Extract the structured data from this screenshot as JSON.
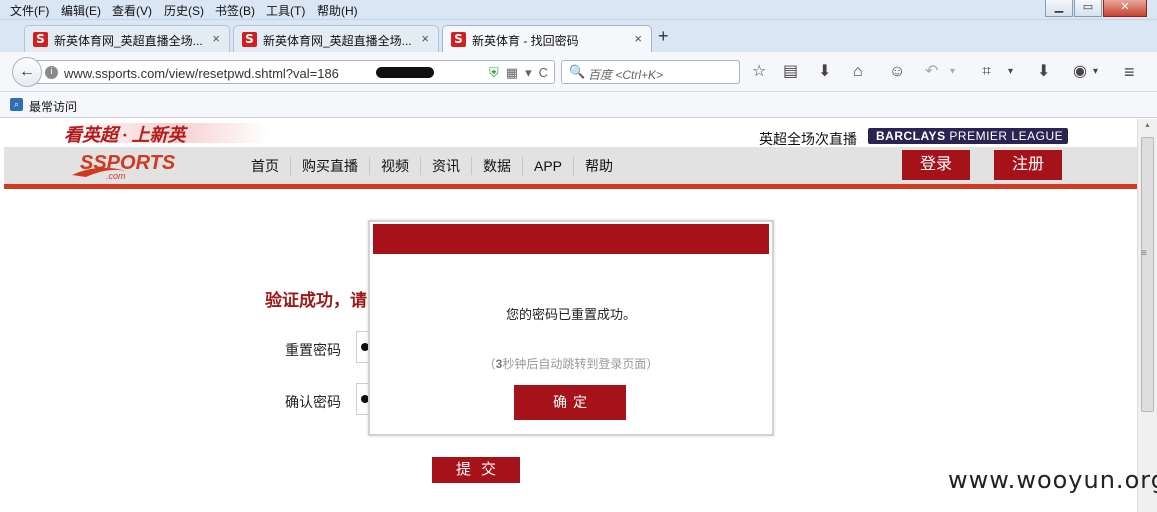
{
  "menu": {
    "items": [
      "文件(F)",
      "编辑(E)",
      "查看(V)",
      "历史(S)",
      "书签(B)",
      "工具(T)",
      "帮助(H)"
    ]
  },
  "window_controls": {
    "minimize": "▁",
    "maximize": "▭",
    "close": "✕"
  },
  "tabs": [
    {
      "label": "新英体育网_英超直播全场...",
      "favicon": "S",
      "close": "×",
      "active": false
    },
    {
      "label": "新英体育网_英超直播全场...",
      "favicon": "S",
      "close": "×",
      "active": false
    },
    {
      "label": "新英体育 - 找回密码",
      "favicon": "S",
      "close": "×",
      "active": true
    }
  ],
  "new_tab": "+",
  "nav": {
    "back": "←",
    "url": "www.ssports.com/view/resetpwd.shtml?val=186",
    "search_placeholder": "百度 <Ctrl+K>",
    "search_icon": "🔍",
    "url_icons": {
      "shield": "⛨",
      "qr": "▦",
      "dropdown": "▾",
      "reload": "C"
    }
  },
  "toolbar_icons": [
    "star-icon",
    "reading-list-icon",
    "download-icon",
    "home-icon",
    "chat-icon",
    "undo-icon",
    "crop-icon",
    "save-icon",
    "profile-icon",
    "hamburger-menu-icon"
  ],
  "bookmarks": {
    "label": "最常访问"
  },
  "site": {
    "slogan": "看英超 · 上新英",
    "premier_label": "英超全场次直播",
    "premier_badge_1": "BARCLAYS",
    "premier_badge_2": "PREMIER LEAGUE",
    "logo_text": "SSPORTS",
    "logo_sub": ".com",
    "nav_links": [
      "首页",
      "购买直播",
      "视频",
      "资讯",
      "数据",
      "APP",
      "帮助"
    ],
    "login_label": "登录",
    "register_label": "注册"
  },
  "form": {
    "heading": "验证成功，请",
    "reset_label": "重置密码",
    "confirm_label": "确认密码",
    "submit_label": "提交"
  },
  "modal": {
    "message": "您的密码已重置成功。",
    "sub_open": "（",
    "sub_seconds": "3",
    "sub_text": "秒钟后自动跳转到登录页面",
    "sub_close": "）",
    "confirm_label": "确定"
  },
  "watermark": "www.wooyun.org",
  "colors": {
    "brand_red": "#a5121a",
    "accent_orange": "#cf3a20",
    "nav_gray": "#e2e2e2"
  }
}
